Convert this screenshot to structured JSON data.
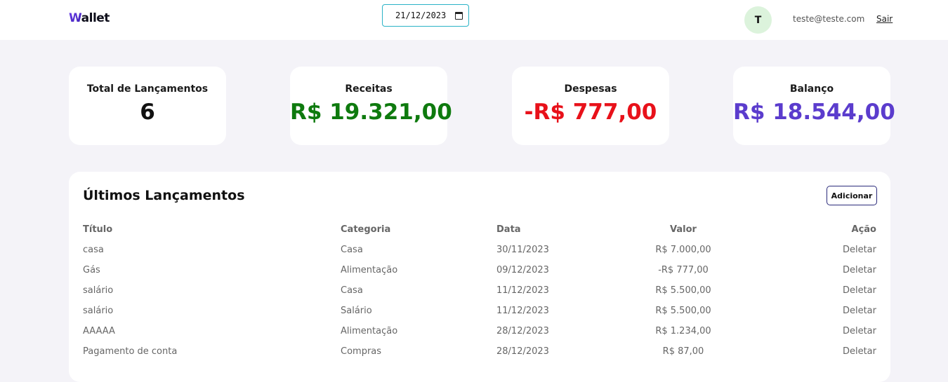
{
  "header": {
    "logo_first": "W",
    "logo_rest": "allet",
    "date_value": "21/12/2023",
    "avatar_initial": "T",
    "user_email": "teste@teste.com",
    "logout_label": "Sair"
  },
  "cards": [
    {
      "label": "Total de Lançamentos",
      "value": "6",
      "color": "#111111"
    },
    {
      "label": "Receitas",
      "value": "R$ 19.321,00",
      "color": "#0e7a0e"
    },
    {
      "label": "Despesas",
      "value": "-R$ 777,00",
      "color": "#e8111a"
    },
    {
      "label": "Balanço",
      "value": "R$ 18.544,00",
      "color": "#5b3ccd"
    }
  ],
  "table": {
    "title": "Últimos Lançamentos",
    "add_label": "Adicionar",
    "columns": [
      "Título",
      "Categoria",
      "Data",
      "Valor",
      "Ação"
    ],
    "rows": [
      {
        "title": "casa",
        "category": "Casa",
        "date": "30/11/2023",
        "value": "R$ 7.000,00",
        "action": "Deletar"
      },
      {
        "title": "Gás",
        "category": "Alimentação",
        "date": "09/12/2023",
        "value": "-R$ 777,00",
        "action": "Deletar"
      },
      {
        "title": "salário",
        "category": "Casa",
        "date": "11/12/2023",
        "value": "R$ 5.500,00",
        "action": "Deletar"
      },
      {
        "title": "salário",
        "category": "Salário",
        "date": "11/12/2023",
        "value": "R$ 5.500,00",
        "action": "Deletar"
      },
      {
        "title": "AAAAA",
        "category": "Alimentação",
        "date": "28/12/2023",
        "value": "R$ 1.234,00",
        "action": "Deletar"
      },
      {
        "title": "Pagamento de conta",
        "category": "Compras",
        "date": "28/12/2023",
        "value": "R$ 87,00",
        "action": "Deletar"
      }
    ]
  }
}
